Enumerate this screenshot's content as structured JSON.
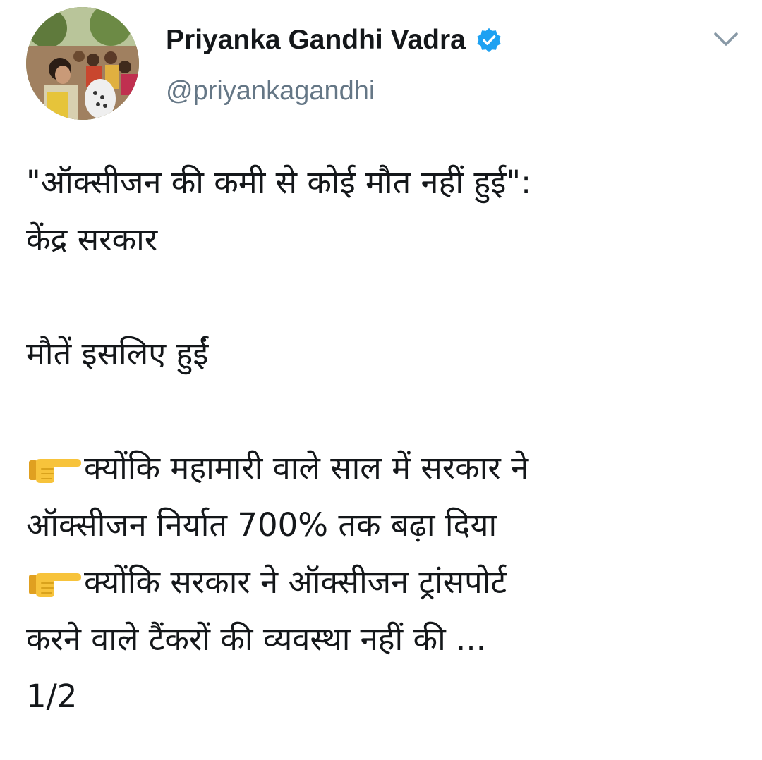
{
  "user": {
    "display_name": "Priyanka Gandhi Vadra",
    "handle": "@priyankagandhi",
    "verified_icon": "verified-badge-icon",
    "avatar_icon": "profile-photo"
  },
  "menu": {
    "icon": "chevron-down-icon"
  },
  "tweet": {
    "line1": "\"ऑक्सीजन की कमी से कोई मौत नहीं हुई\":",
    "line2": "केंद्र सरकार",
    "line3": "मौतें इसलिए हुईं",
    "bullet_icon": "backhand-index-pointing-right-icon",
    "bullet1_line1": "क्योंकि महामारी वाले साल में सरकार ने",
    "bullet1_line2": "ऑक्सीजन निर्यात 700% तक बढ़ा दिया",
    "bullet2_line1": "क्योंकि सरकार ने ऑक्सीजन ट्रांसपोर्ट",
    "bullet2_line2": "करने वाले टैंकरों की व्यवस्था नहीं की ...",
    "thread_count": "1/2"
  },
  "colors": {
    "text": "#14171a",
    "secondary": "#657786",
    "verified_blue": "#1da1f2",
    "emoji_yellow": "#f7c33b"
  }
}
